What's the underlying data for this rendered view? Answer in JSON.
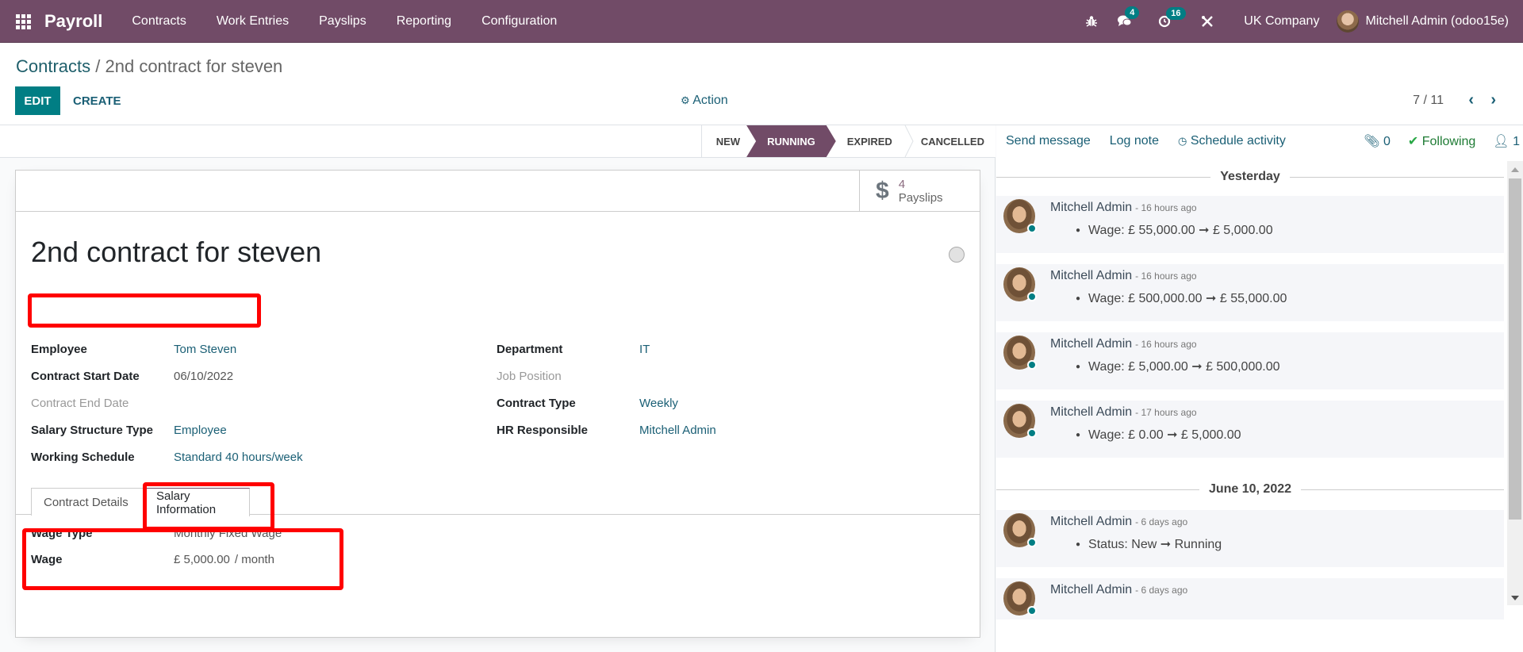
{
  "navbar": {
    "app_name": "Payroll",
    "menu": [
      "Contracts",
      "Work Entries",
      "Payslips",
      "Reporting",
      "Configuration"
    ],
    "messages_count": "4",
    "activities_count": "16",
    "company": "UK Company",
    "user": "Mitchell Admin (odoo15e)"
  },
  "control_panel": {
    "breadcrumb_parent": "Contracts",
    "breadcrumb_separator": " / ",
    "breadcrumb_current": "2nd contract for steven",
    "edit_label": "EDIT",
    "create_label": "CREATE",
    "action_label": "Action",
    "pager": "7 / 11"
  },
  "statusbar": {
    "steps": [
      "NEW",
      "RUNNING",
      "EXPIRED",
      "CANCELLED"
    ],
    "active": "RUNNING"
  },
  "smart_button": {
    "value": "4",
    "label": "Payslips"
  },
  "record": {
    "title": "2nd contract for steven",
    "left_fields": [
      {
        "label": "Employee",
        "value": "Tom Steven"
      },
      {
        "label": "Contract Start Date",
        "value": "06/10/2022"
      },
      {
        "label": "Contract End Date",
        "value": ""
      },
      {
        "label": "Salary Structure Type",
        "value": "Employee"
      },
      {
        "label": "Working Schedule",
        "value": "Standard 40 hours/week"
      }
    ],
    "right_fields": [
      {
        "label": "Department",
        "value": "IT"
      },
      {
        "label": "Job Position",
        "value": ""
      },
      {
        "label": "Contract Type",
        "value": "Weekly"
      },
      {
        "label": "HR Responsible",
        "value": "Mitchell Admin"
      }
    ]
  },
  "tabs": [
    "Contract Details",
    "Salary Information"
  ],
  "active_tab": "Salary Information",
  "salary": {
    "wage_type_label": "Wage Type",
    "wage_type_value": "Monthly Fixed Wage",
    "wage_label": "Wage",
    "wage_value": "£ 5,000.00",
    "wage_unit": "/ month"
  },
  "chatter": {
    "send_message": "Send message",
    "log_note": "Log note",
    "schedule_activity": "Schedule activity",
    "attachments": "0",
    "following": "Following",
    "followers": "1",
    "groups": [
      {
        "date": "Yesterday",
        "messages": [
          {
            "author": "Mitchell Admin",
            "time": "- 16 hours ago",
            "change": "Wage: £ 55,000.00 ➞ £ 5,000.00"
          },
          {
            "author": "Mitchell Admin",
            "time": "- 16 hours ago",
            "change": "Wage: £ 500,000.00 ➞ £ 55,000.00"
          },
          {
            "author": "Mitchell Admin",
            "time": "- 16 hours ago",
            "change": "Wage: £ 5,000.00 ➞ £ 500,000.00"
          },
          {
            "author": "Mitchell Admin",
            "time": "- 17 hours ago",
            "change": "Wage: £ 0.00 ➞ £ 5,000.00"
          }
        ]
      },
      {
        "date": "June 10, 2022",
        "messages": [
          {
            "author": "Mitchell Admin",
            "time": "- 6 days ago",
            "change": "Status: New ➞ Running"
          },
          {
            "author": "Mitchell Admin",
            "time": "- 6 days ago",
            "change": ""
          }
        ]
      }
    ]
  }
}
